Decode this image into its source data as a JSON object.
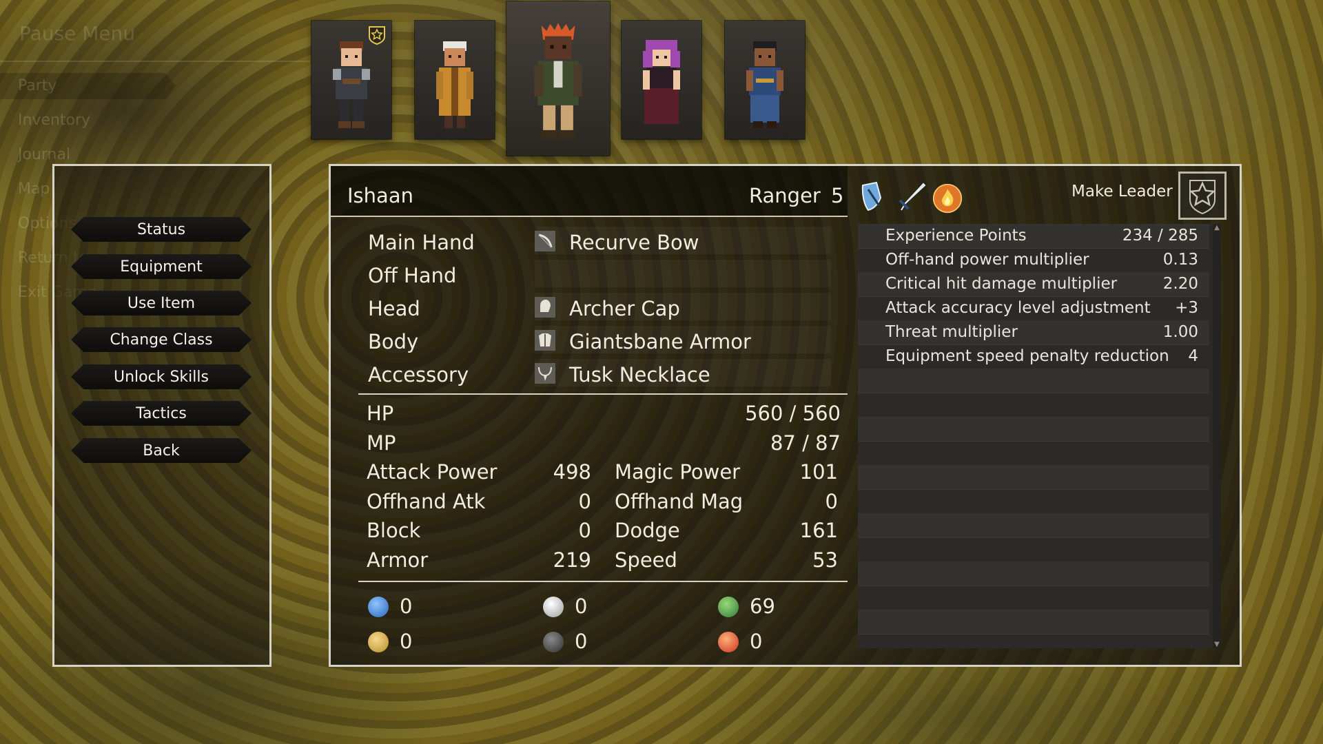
{
  "pause_menu": {
    "title": "Pause Menu",
    "items": [
      "Party",
      "Inventory",
      "Journal",
      "Map",
      "Options",
      "Return to",
      "Exit Game"
    ]
  },
  "party": {
    "members": [
      {
        "sprite": "hero-sprite",
        "leader": true
      },
      {
        "sprite": "mage-sprite",
        "leader": false
      },
      {
        "sprite": "ranger-sprite",
        "leader": false,
        "selected": true
      },
      {
        "sprite": "witch-sprite",
        "leader": false
      },
      {
        "sprite": "monk-sprite",
        "leader": false
      }
    ],
    "leader_icon": "star-shield-icon"
  },
  "commands": [
    "Status",
    "Equipment",
    "Use Item",
    "Change Class",
    "Unlock Skills",
    "Tactics",
    "Back"
  ],
  "character": {
    "name": "Ishaan",
    "class": "Ranger",
    "level": "5",
    "class_icons": [
      "shield-sword-icon",
      "sword-icon",
      "fire-icon"
    ],
    "make_leader": "Make Leader"
  },
  "equipment": [
    {
      "slot": "Main Hand",
      "item": "Recurve Bow",
      "icon": "bow-icon"
    },
    {
      "slot": "Off Hand",
      "item": "",
      "icon": ""
    },
    {
      "slot": "Head",
      "item": "Archer Cap",
      "icon": "cap-icon"
    },
    {
      "slot": "Body",
      "item": "Giantsbane Armor",
      "icon": "armor-icon"
    },
    {
      "slot": "Accessory",
      "item": "Tusk Necklace",
      "icon": "necklace-icon"
    }
  ],
  "vitals": {
    "hp": {
      "label": "HP",
      "value": "560 / 560"
    },
    "mp": {
      "label": "MP",
      "value": "87 / 87"
    }
  },
  "stats_left": [
    {
      "label": "Attack Power",
      "value": "498"
    },
    {
      "label": "Offhand Atk",
      "value": "0"
    },
    {
      "label": "Block",
      "value": "0"
    },
    {
      "label": "Armor",
      "value": "219"
    }
  ],
  "stats_right": [
    {
      "label": "Magic Power",
      "value": "101"
    },
    {
      "label": "Offhand Mag",
      "value": "0"
    },
    {
      "label": "Dodge",
      "value": "161"
    },
    {
      "label": "Speed",
      "value": "53"
    }
  ],
  "resistances": [
    {
      "icon": "frost-icon",
      "value": "0",
      "color": "#3a7fd0"
    },
    {
      "icon": "light-icon",
      "value": "0",
      "color": "#cfcfcf"
    },
    {
      "icon": "nature-icon",
      "value": "69",
      "color": "#3f9a4a"
    },
    {
      "icon": "earth-icon",
      "value": "0",
      "color": "#c9a23c"
    },
    {
      "icon": "shadow-icon",
      "value": "0",
      "color": "#5a5a5a"
    },
    {
      "icon": "fire-icon",
      "value": "0",
      "color": "#d8442a"
    }
  ],
  "info_list": [
    {
      "label": "Experience Points",
      "value": "234 / 285"
    },
    {
      "label": "Off-hand power multiplier",
      "value": "0.13"
    },
    {
      "label": "Critical hit damage multiplier",
      "value": "2.20"
    },
    {
      "label": "Attack accuracy level adjustment",
      "value": "+3"
    },
    {
      "label": "Threat multiplier",
      "value": "1.00"
    },
    {
      "label": "Equipment speed penalty reduction",
      "value": "4"
    }
  ]
}
